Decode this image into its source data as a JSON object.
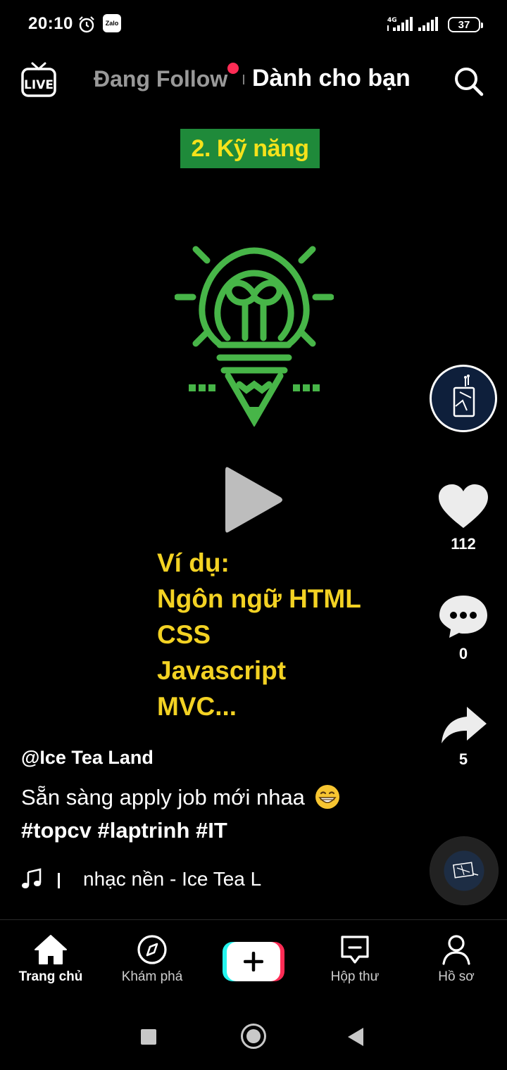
{
  "status_bar": {
    "time": "20:10",
    "network_label": "4G",
    "battery": "37",
    "icons": [
      "alarm-icon",
      "zalo-icon",
      "signal-icon",
      "signal-icon",
      "battery-icon"
    ]
  },
  "top_nav": {
    "live_label": "LIVE",
    "tabs": [
      {
        "label": "Đang Follow",
        "active": false,
        "has_notification_dot": true
      },
      {
        "label": "Dành cho bạn",
        "active": true
      }
    ],
    "search_icon": "search-icon"
  },
  "video": {
    "banner": "2. Kỹ năng",
    "example_lines": [
      "Ví dụ:",
      "Ngôn ngữ HTML",
      "CSS",
      "Javascript",
      "MVC..."
    ],
    "state": "paused",
    "colors": {
      "banner_bg": "#1f8a3a",
      "banner_text": "#f5e21b",
      "bulb": "#47b548",
      "example_text": "#f3d223"
    }
  },
  "actions": {
    "likes": "112",
    "comments": "0",
    "shares": "5"
  },
  "post": {
    "author": "@Ice Tea Land",
    "description": "Sẵn sàng apply job mới nhaa",
    "emoji": "grinning-face",
    "hashtags": "#topcv #laptrinh #IT",
    "music": "nhạc nền - Ice Tea L"
  },
  "bottom_nav": {
    "items": [
      {
        "label": "Trang chủ",
        "icon": "home-icon",
        "active": true
      },
      {
        "label": "Khám phá",
        "icon": "compass-icon",
        "active": false
      },
      {
        "label": "Hộp thư",
        "icon": "inbox-icon",
        "active": false
      },
      {
        "label": "Hồ sơ",
        "icon": "profile-icon",
        "active": false
      }
    ],
    "create_icon": "plus-icon"
  },
  "colors": {
    "accent": "#fe2c55",
    "accent_alt": "#25f4ee",
    "background": "#000000"
  }
}
